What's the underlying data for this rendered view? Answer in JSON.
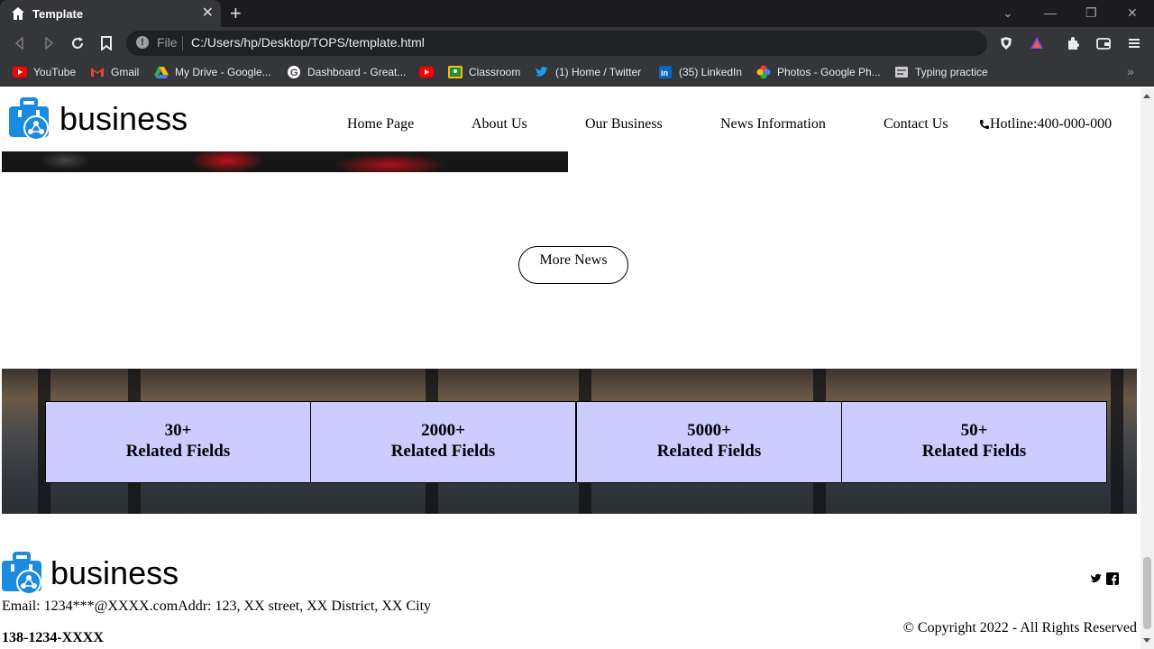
{
  "browser": {
    "tab_title": "Template",
    "url_scheme": "File",
    "url": "C:/Users/hp/Desktop/TOPS/template.html",
    "bookmarks": [
      {
        "label": "YouTube",
        "icon": "youtube-icon"
      },
      {
        "label": "Gmail",
        "icon": "gmail-icon"
      },
      {
        "label": "My Drive - Google...",
        "icon": "google-drive-icon"
      },
      {
        "label": "Dashboard - Great...",
        "icon": "google-icon"
      },
      {
        "label": "",
        "icon": "youtube-icon"
      },
      {
        "label": "Classroom",
        "icon": "classroom-icon"
      },
      {
        "label": "(1) Home / Twitter",
        "icon": "twitter-icon"
      },
      {
        "label": "(35) LinkedIn",
        "icon": "linkedin-icon"
      },
      {
        "label": "Photos - Google Ph...",
        "icon": "google-photos-icon"
      },
      {
        "label": "Typing practice",
        "icon": "typing-icon"
      }
    ]
  },
  "site": {
    "brand": "business",
    "nav": [
      "Home Page",
      "About Us",
      "Our Business",
      "News Information",
      "Contact Us"
    ],
    "hotline": "Hotline:400-000-000",
    "more_news": "More News",
    "stats": [
      {
        "value": "30+",
        "label": "Related Fields"
      },
      {
        "value": "2000+",
        "label": "Related Fields"
      },
      {
        "value": "5000+",
        "label": "Related Fields"
      },
      {
        "value": "50+",
        "label": "Related Fields"
      }
    ],
    "footer": {
      "contact": "Email: 1234***@XXXX.comAddr: 123, XX street, XX District, XX City",
      "phone": "138-1234-XXXX",
      "copyright": "© Copyright 2022 - All Rights Reserved"
    }
  },
  "colors": {
    "stat_box": "#ccccff",
    "logo_blue": "#1b8be0"
  }
}
